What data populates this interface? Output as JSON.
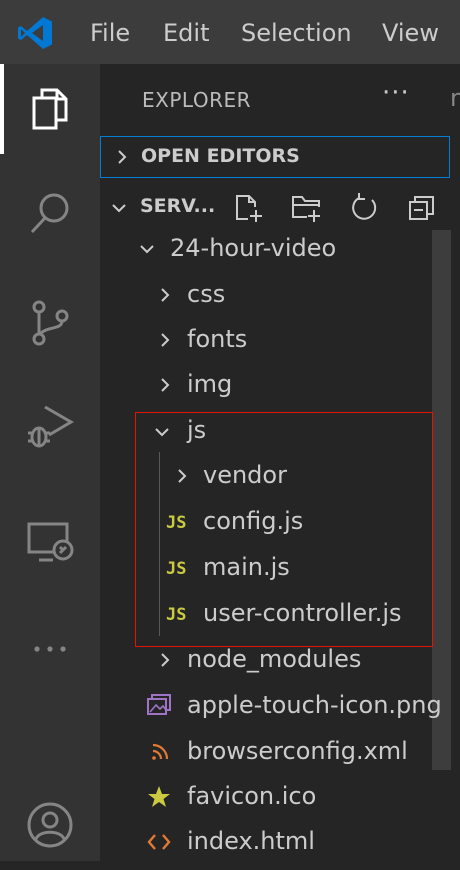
{
  "menu": {
    "file": "File",
    "edit": "Edit",
    "selection": "Selection",
    "view": "View"
  },
  "activity_bar": [
    "explorer-icon",
    "search-icon",
    "source-control-icon",
    "run-debug-icon",
    "remote-explorer-icon",
    "ellipsis-icon",
    "account-icon"
  ],
  "explorer": {
    "title": "EXPLORER",
    "more": "···",
    "edge_char": "n",
    "open_editors": "OPEN EDITORS",
    "section": "SERV..."
  },
  "tree": {
    "root": "24-hour-video",
    "css": "css",
    "fonts": "fonts",
    "img": "img",
    "js": "js",
    "vendor": "vendor",
    "config": "config.js",
    "main": "main.js",
    "user_controller": "user-controller.js",
    "node_modules": "node_modules",
    "apple_touch": "apple-touch-icon.png",
    "browserconfig": "browserconfig.xml",
    "favicon": "favicon.ico",
    "index": "index.html",
    "js_badge": "JS"
  },
  "colors": {
    "accent": "#007fd4",
    "highlight_box": "#e51400",
    "js_icon": "#cbcb41",
    "image_icon": "#a074c4",
    "rss_icon": "#e37933",
    "star_icon": "#cbcb41",
    "html_icon": "#e37933"
  }
}
